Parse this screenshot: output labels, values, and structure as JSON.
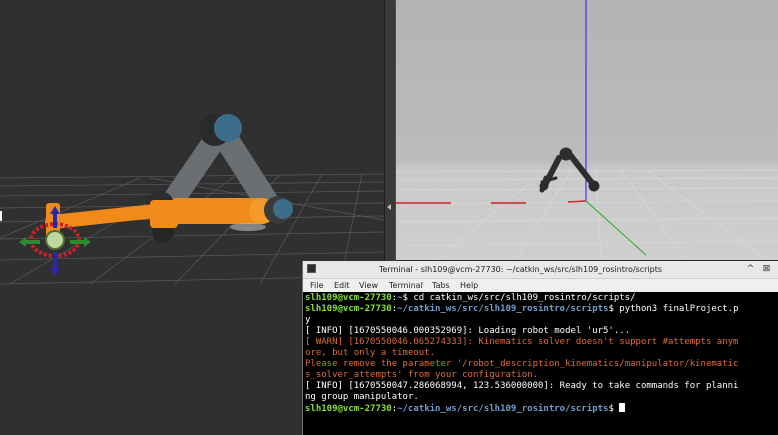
{
  "terminal": {
    "title": "Terminal - slh109@vcm-27730: ~/catkin_ws/src/slh109_rosintro/scripts",
    "menu": [
      "File",
      "Edit",
      "View",
      "Terminal",
      "Tabs",
      "Help"
    ],
    "minimize_glyph": "^",
    "close_glyph": "⊠",
    "prompt_user": "slh109@vcm-27730",
    "prompt_sep": ":",
    "line1_path": "~",
    "line1_cmd": "$ cd catkin_ws/src/slh109_rosintro/scripts/",
    "line2_path": "~/catkin_ws/src/slh109_rosintro/scripts",
    "line2_cmd": "$ python3 finalProject.p",
    "line2_wrap": "y",
    "info1": "[ INFO] [1670550046.000352969]: Loading robot model 'ur5'...",
    "warn1": "[ WARN] [1670550046.065274333]: Kinematics solver doesn't support #attempts anym",
    "warn2": "ore, but only a timeout.",
    "warn3": "Please remove the parameter '/robot_description_kinematics/manipulator/kinematic",
    "warn4": "s_solver_attempts' from your configuration.",
    "info2": "[ INFO] [1670550047.286068994, 123.536000000]: Ready to take commands for planni",
    "info3": "ng group manipulator.",
    "line3_path": "~/catkin_ws/src/slh109_rosintro/scripts",
    "line3_cmd": "$ "
  },
  "colors": {
    "robot_orange": "#f08a1a",
    "robot_gray": "#6b6f73",
    "joint_cap": "#3c6e8c",
    "prompt_green": "#8ae234",
    "prompt_blue": "#729fcf",
    "warn_orange": "#e06c36"
  }
}
